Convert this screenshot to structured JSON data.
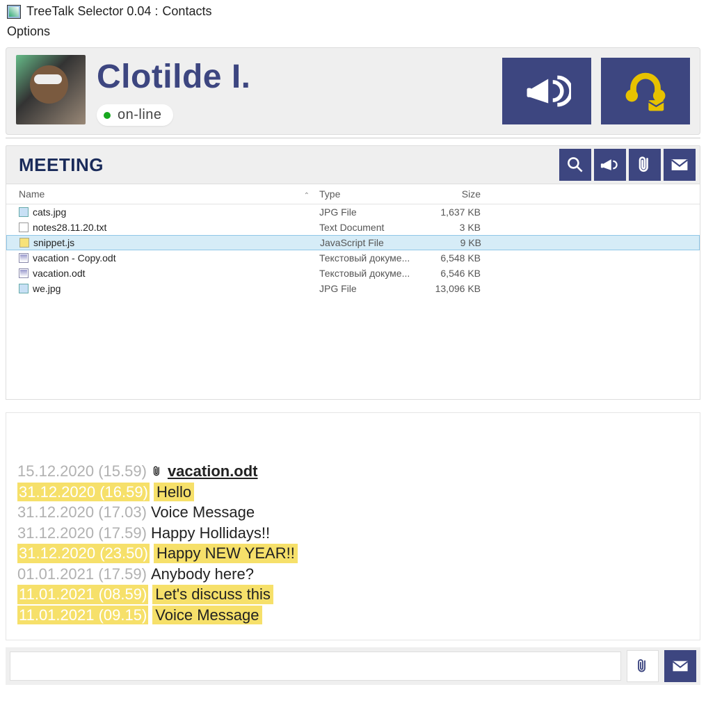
{
  "titlebar": {
    "app_name": "TreeTalk Selector 0.04 :",
    "section": "Contacts"
  },
  "menubar": {
    "options": "Options"
  },
  "header": {
    "name": "Clotilde I.",
    "status": "on-line"
  },
  "section": {
    "title": "MEETING"
  },
  "file_table": {
    "columns": {
      "name": "Name",
      "type": "Type",
      "size": "Size"
    },
    "rows": [
      {
        "icon": "jpg",
        "name": "cats.jpg",
        "type": "JPG File",
        "size": "1,637 KB",
        "selected": false
      },
      {
        "icon": "txt",
        "name": "notes28.11.20.txt",
        "type": "Text Document",
        "size": "3 KB",
        "selected": false
      },
      {
        "icon": "js",
        "name": "snippet.js",
        "type": "JavaScript File",
        "size": "9 KB",
        "selected": true
      },
      {
        "icon": "odt",
        "name": "vacation - Copy.odt",
        "type": "Текстовый докуме...",
        "size": "6,548 KB",
        "selected": false
      },
      {
        "icon": "odt",
        "name": "vacation.odt",
        "type": "Текстовый докуме...",
        "size": "6,546 KB",
        "selected": false
      },
      {
        "icon": "jpg",
        "name": "we.jpg",
        "type": "JPG File",
        "size": "13,096 KB",
        "selected": false
      }
    ]
  },
  "chat": [
    {
      "ts": "15.12.2020 (15.59)",
      "attachment": true,
      "text": "vacation.odt",
      "hl": false,
      "link": true
    },
    {
      "ts": "31.12.2020 (16.59)",
      "text": "Hello",
      "hl": true
    },
    {
      "ts": "31.12.2020 (17.03)",
      "text": "Voice Message",
      "hl": false
    },
    {
      "ts": "31.12.2020 (17.59)",
      "text": "Happy Hollidays!!",
      "hl": false
    },
    {
      "ts": "31.12.2020 (23.50)",
      "text": "Happy NEW YEAR!!",
      "hl": true
    },
    {
      "ts": "01.01.2021 (17.59)",
      "text": "Anybody here?",
      "hl": false
    },
    {
      "ts": "11.01.2021 (08.59)",
      "text": "Let's discuss this",
      "hl": true
    },
    {
      "ts": "11.01.2021 (09.15)",
      "text": "Voice Message",
      "hl": true
    }
  ],
  "input": {
    "placeholder": ""
  }
}
